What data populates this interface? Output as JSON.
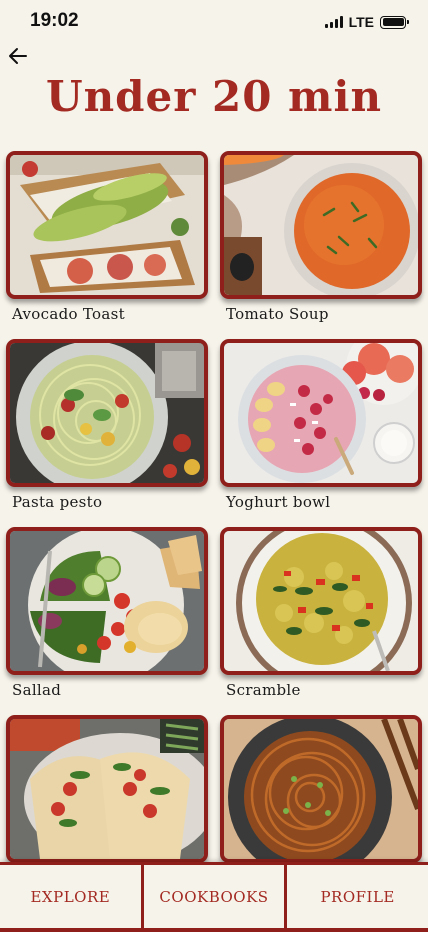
{
  "status": {
    "time": "19:02",
    "network": "LTE"
  },
  "header": {
    "title": "Under 20 min"
  },
  "recipes": [
    {
      "label": "Avocado Toast"
    },
    {
      "label": "Tomato Soup"
    },
    {
      "label": "Pasta pesto"
    },
    {
      "label": "Yoghurt bowl"
    },
    {
      "label": "Sallad"
    },
    {
      "label": "Scramble"
    },
    {
      "label": ""
    },
    {
      "label": ""
    }
  ],
  "tabs": [
    {
      "label": "EXPLORE"
    },
    {
      "label": "COOKBOOKS"
    },
    {
      "label": "PROFILE"
    }
  ],
  "colors": {
    "accent": "#a32a22",
    "border": "#8e1f1a",
    "background": "#f6f3ea"
  },
  "icons": {
    "back": "arrow-left-icon",
    "signal": "signal-icon",
    "battery": "battery-icon"
  }
}
